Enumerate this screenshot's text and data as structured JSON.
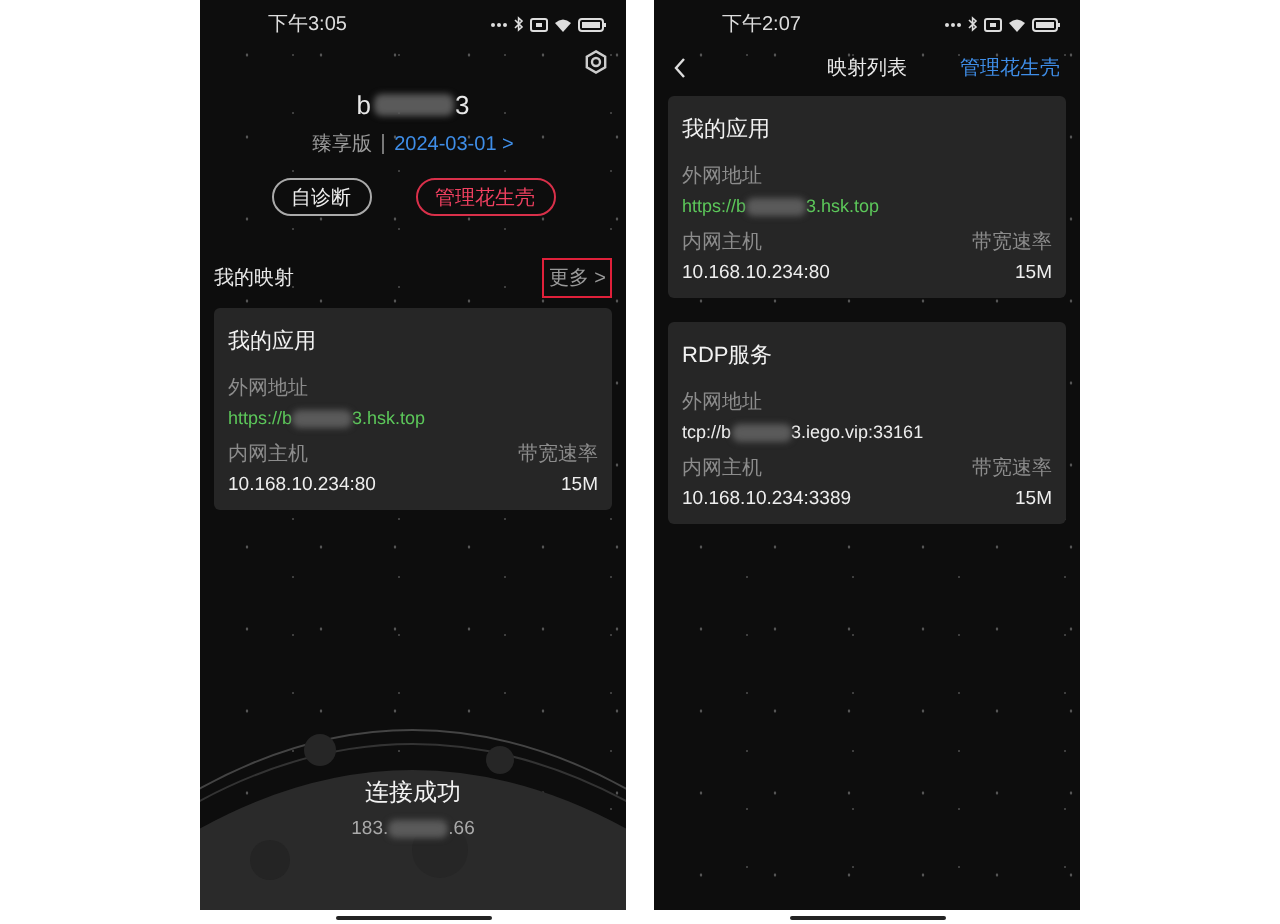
{
  "home": {
    "status_bar": {
      "time": "下午3:05"
    },
    "account": {
      "name_parts": [
        "b",
        "3"
      ],
      "plan": "臻享版",
      "expiry": "2024-03-01 >"
    },
    "buttons": [
      {
        "label": "自诊断",
        "kind": "neutral"
      },
      {
        "label": "管理花生壳",
        "kind": "danger"
      }
    ],
    "section": {
      "title": "我的映射",
      "more": "更多 >",
      "more_highlighted": true
    },
    "mappings": [
      {
        "name": "我的应用",
        "external_label": "外网地址",
        "external_parts": [
          "https://b",
          "3.hsk.top"
        ],
        "linked": true,
        "internal_label": "内网主机",
        "internal_host": "10.168.10.234:80",
        "bandwidth_label": "带宽速率",
        "bandwidth": "15M"
      }
    ],
    "connection": {
      "status": "连接成功",
      "ip_parts": [
        "183.",
        ".66"
      ]
    }
  },
  "list": {
    "status_bar": {
      "time": "下午2:07"
    },
    "title": "映射列表",
    "action": "管理花生壳",
    "mappings": [
      {
        "name": "我的应用",
        "external_label": "外网地址",
        "external_parts": [
          "https://b",
          "3.hsk.top"
        ],
        "linked": true,
        "internal_label": "内网主机",
        "internal_host": "10.168.10.234:80",
        "bandwidth_label": "带宽速率",
        "bandwidth": "15M"
      },
      {
        "name": "RDP服务",
        "external_label": "外网地址",
        "external_parts": [
          "tcp://b",
          "3.iego.vip:33161"
        ],
        "linked": false,
        "internal_label": "内网主机",
        "internal_host": "10.168.10.234:3389",
        "bandwidth_label": "带宽速率",
        "bandwidth": "15M"
      }
    ]
  }
}
